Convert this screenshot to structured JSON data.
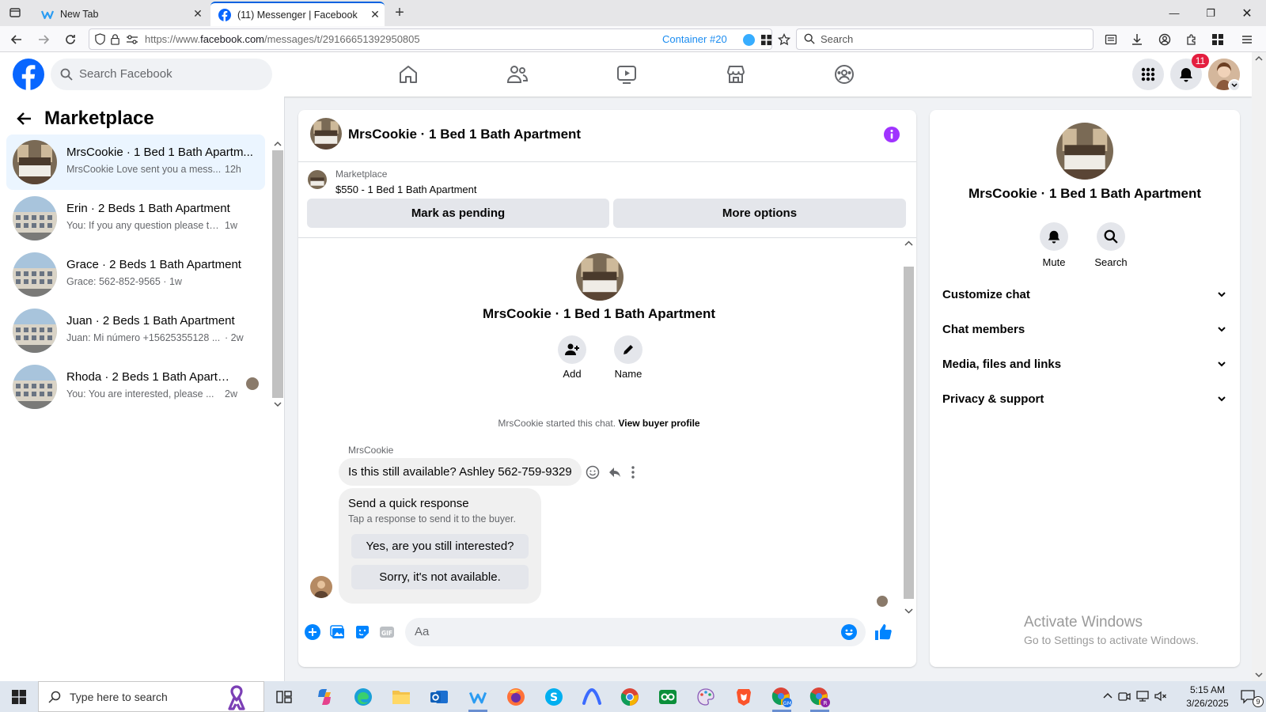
{
  "browser": {
    "tabs": [
      {
        "title": "New Tab",
        "active": false
      },
      {
        "title": "(11) Messenger | Facebook",
        "active": true
      }
    ],
    "url_prefix": "https://www.",
    "url_domain": "facebook.com",
    "url_path": "/messages/t/29166651392950805",
    "container_label": "Container #20",
    "search_placeholder": "Search"
  },
  "fb_header": {
    "search_placeholder": "Search Facebook",
    "notification_count": "11"
  },
  "left_panel": {
    "title": "Marketplace",
    "conversations": [
      {
        "name": "MrsCookie · 1 Bed 1 Bath Apartm...",
        "snippet": "MrsCookie Love sent you a mess...",
        "time": "12h",
        "active": true
      },
      {
        "name": "Erin · 2 Beds 1 Bath Apartment",
        "snippet": "You: If you any question please te...",
        "time": "1w",
        "active": false
      },
      {
        "name": "Grace · 2 Beds 1 Bath Apartment",
        "snippet": "Grace: 562-852-9565 · 1w",
        "time": "",
        "active": false
      },
      {
        "name": "Juan · 2 Beds 1 Bath Apartment",
        "snippet": "Juan: Mi número +15625355128 ...",
        "time": "· 2w",
        "active": false
      },
      {
        "name": "Rhoda · 2 Beds 1 Bath Apartm...",
        "snippet": "You: You are interested, please ...",
        "time": "2w",
        "active": false
      }
    ]
  },
  "chat": {
    "title": "MrsCookie · 1 Bed 1 Bath Apartment",
    "listing_kind": "Marketplace",
    "listing_price": "$550 - 1 Bed 1 Bath Apartment",
    "mark_pending_label": "Mark as pending",
    "more_options_label": "More options",
    "center_name": "MrsCookie · 1 Bed 1 Bath Apartment",
    "add_label": "Add",
    "name_label": "Name",
    "started_text": "MrsCookie started this chat.",
    "view_profile_label": "View buyer profile",
    "sender": "MrsCookie",
    "message": "Is this still available? Ashley 562-759-9329",
    "quick_title": "Send a quick response",
    "quick_sub": "Tap a response to send it to the buyer.",
    "quick_replies": [
      "Yes, are you still interested?",
      "Sorry, it's not available."
    ],
    "composer_placeholder": "Aa"
  },
  "info_panel": {
    "name": "MrsCookie · 1 Bed 1 Bath Apartment",
    "mute_label": "Mute",
    "search_label": "Search",
    "sections": [
      "Customize chat",
      "Chat members",
      "Media, files and links",
      "Privacy & support"
    ]
  },
  "watermark": {
    "line1": "Activate Windows",
    "line2": "Go to Settings to activate Windows."
  },
  "taskbar": {
    "search_placeholder": "Type here to search",
    "time": "5:15 AM",
    "date": "3/26/2025",
    "notification_count": "9"
  },
  "colors": {
    "facebook_blue": "#0866ff",
    "messenger_blue": "#0084ff",
    "info_purple": "#a033ff",
    "badge_red": "#e41e3f",
    "active_row": "#ebf5ff"
  }
}
